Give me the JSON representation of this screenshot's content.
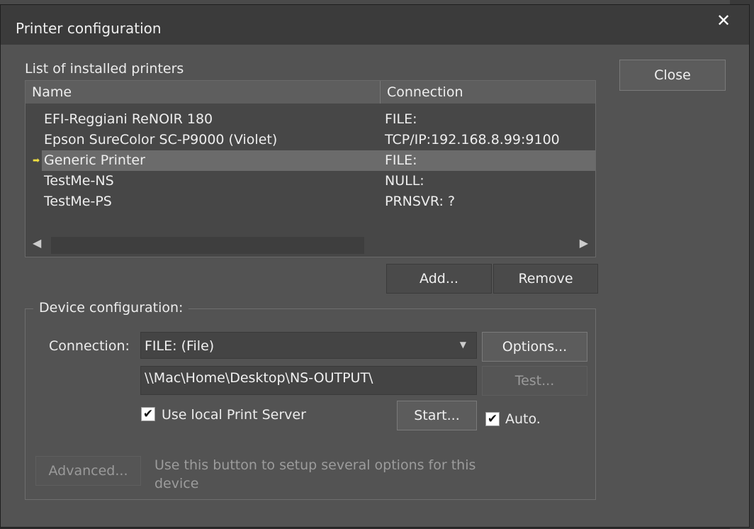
{
  "dialog": {
    "title": "Printer configuration",
    "close_icon": "close-icon"
  },
  "printers": {
    "label": "List of installed printers",
    "columns": {
      "name": "Name",
      "connection": "Connection"
    },
    "rows": [
      {
        "name": "EFI-Reggiani ReNOIR 180",
        "connection": "FILE:"
      },
      {
        "name": "Epson SureColor SC-P9000 (Violet)",
        "connection": "TCP/IP:192.168.8.99:9100"
      },
      {
        "name": "Generic Printer",
        "connection": "FILE:"
      },
      {
        "name": "TestMe-NS",
        "connection": "NULL:"
      },
      {
        "name": "TestMe-PS",
        "connection": "PRNSVR: ?"
      }
    ],
    "selected_index": 2,
    "selected_marker_icon": "current-arrow-icon"
  },
  "buttons": {
    "close": "Close",
    "add": "Add...",
    "remove": "Remove",
    "options": "Options...",
    "test": "Test...",
    "start": "Start...",
    "advanced": "Advanced..."
  },
  "device_config": {
    "title": "Device configuration:",
    "connection_label": "Connection:",
    "connection_value": "FILE: (File)",
    "path_value": "\\\\Mac\\Home\\Desktop\\NS-OUTPUT\\",
    "use_local_print_server_label": "Use local Print Server",
    "use_local_print_server_checked": true,
    "auto_label": "Auto.",
    "auto_checked": true,
    "advanced_hint": "Use this button to setup several options for this device"
  },
  "colors": {
    "dialog_bg": "#535353",
    "titlebar_bg": "#3b3b3b",
    "selection_bg": "#6b6b6b",
    "marker": "#f2e040"
  }
}
